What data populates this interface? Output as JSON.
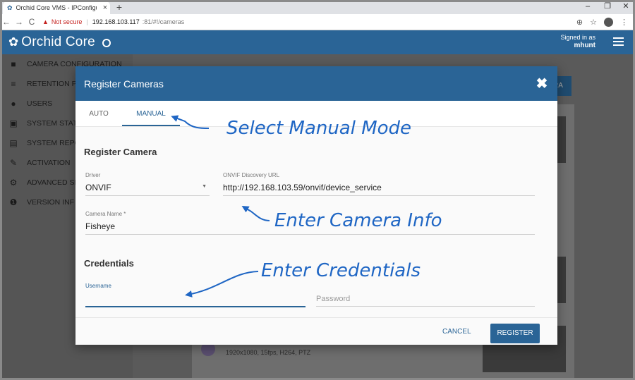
{
  "browser": {
    "tab_title": "Orchid Core VMS - IPConfigure",
    "tab_close": "×",
    "new_tab": "+",
    "min": "–",
    "restore": "❐",
    "close": "✕",
    "not_secure": "Not secure",
    "url_host": "192.168.103.117",
    "url_path": ":81/#!/cameras"
  },
  "header": {
    "app_title": "Orchid Core",
    "signed_in_label": "Signed in as",
    "username": "mhunt"
  },
  "sidebar": {
    "items": [
      {
        "label": "CAMERA CONFIGURATION",
        "icon": "■"
      },
      {
        "label": "RETENTION P",
        "icon": "≡"
      },
      {
        "label": "USERS",
        "icon": "●"
      },
      {
        "label": "SYSTEM STAT",
        "icon": "▣"
      },
      {
        "label": "SYSTEM REPO",
        "icon": "▤"
      },
      {
        "label": "ACTIVATION",
        "icon": "✎"
      },
      {
        "label": "ADVANCED SI",
        "icon": "⚙"
      },
      {
        "label": "VERSION INF",
        "icon": "❶"
      }
    ]
  },
  "background": {
    "add_btn": "RA",
    "resolution": "1920x1080, 15fps, H264, PTZ"
  },
  "modal": {
    "title": "Register Cameras",
    "tabs": [
      "AUTO",
      "MANUAL"
    ],
    "register_section": "Register Camera",
    "driver_label": "Driver",
    "driver_value": "ONVIF",
    "onvif_label": "ONVIF Discovery URL",
    "onvif_value": "http://192.168.103.59/onvif/device_service",
    "camera_name_label": "Camera Name",
    "camera_name_required": " *",
    "camera_name_value": "Fisheye",
    "credentials_section": "Credentials",
    "username_label": "Username",
    "username_value": "",
    "password_placeholder": "Password",
    "cancel_label": "CANCEL",
    "register_label": "REGISTER"
  },
  "annotations": {
    "manual": "Select Manual Mode",
    "camera_info": "Enter Camera Info",
    "credentials": "Enter Credentials"
  },
  "colors": {
    "primary": "#2a6496",
    "annotation": "#1f66c4"
  }
}
